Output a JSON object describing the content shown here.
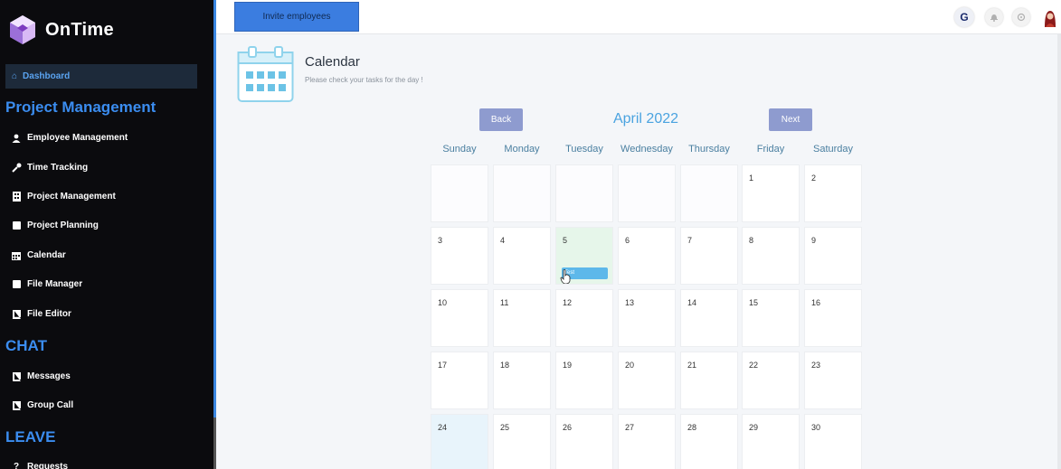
{
  "brand": {
    "name": "OnTime"
  },
  "sidebar": {
    "dashboard": "Dashboard",
    "sections": [
      {
        "title": "Project Management",
        "items": [
          "Employee Management",
          "Time Tracking",
          "Project Management",
          "Project Planning",
          "Calendar",
          "File Manager",
          "File Editor"
        ]
      },
      {
        "title": "CHAT",
        "items": [
          "Messages",
          "Group Call"
        ]
      },
      {
        "title": "LEAVE",
        "items": [
          "Requests"
        ]
      }
    ]
  },
  "topbar": {
    "invite_label": "Invite employees",
    "g_label": "G"
  },
  "calendar": {
    "title": "Calendar",
    "subtitle": "Please check your tasks for the day !",
    "back_label": "Back",
    "next_label": "Next",
    "month": "April 2022",
    "weekdays": [
      "Sunday",
      "Monday",
      "Tuesday",
      "Wednesday",
      "Thursday",
      "Friday",
      "Saturday"
    ],
    "weeks": [
      [
        "",
        "",
        "",
        "",
        "",
        "1",
        "2"
      ],
      [
        "3",
        "4",
        "5",
        "6",
        "7",
        "8",
        "9"
      ],
      [
        "10",
        "11",
        "12",
        "13",
        "14",
        "15",
        "16"
      ],
      [
        "17",
        "18",
        "19",
        "20",
        "21",
        "22",
        "23"
      ],
      [
        "24",
        "25",
        "26",
        "27",
        "28",
        "29",
        "30"
      ]
    ],
    "event_label": "Test"
  },
  "colors": {
    "accent": "#3b8df0",
    "nav_button": "#8e9bcf",
    "today": "#e6f6ea",
    "event": "#5db8ea"
  }
}
